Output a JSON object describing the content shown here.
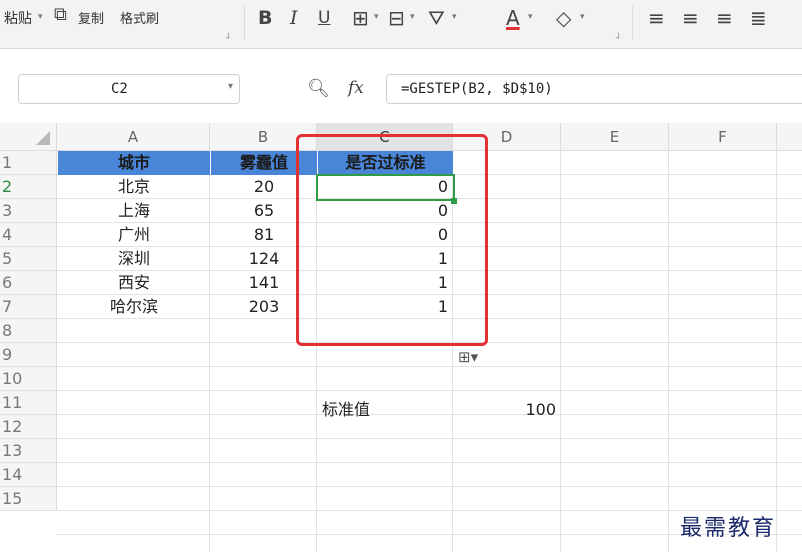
{
  "toolbar": {
    "paste_label": "粘贴",
    "copy_label": "复制",
    "format_painter_label": "格式刷",
    "bold_label": "B",
    "italic_label": "I",
    "underline_label": "U",
    "font_color_label": "A"
  },
  "formula_bar": {
    "name_box": "C2",
    "fx_label": "fx",
    "formula": "=GESTEP(B2, $D$10)"
  },
  "columns": [
    "A",
    "B",
    "C",
    "D",
    "E",
    "F"
  ],
  "rows": [
    "1",
    "2",
    "3",
    "4",
    "5",
    "6",
    "7",
    "8",
    "9",
    "10",
    "11",
    "12",
    "13",
    "14",
    "15"
  ],
  "table": {
    "headers": [
      "城市",
      "雾霾值",
      "是否过标准"
    ],
    "rows": [
      {
        "city": "北京",
        "value": "20",
        "result": "0"
      },
      {
        "city": "上海",
        "value": "65",
        "result": "0"
      },
      {
        "city": "广州",
        "value": "81",
        "result": "0"
      },
      {
        "city": "深圳",
        "value": "124",
        "result": "1"
      },
      {
        "city": "西安",
        "value": "141",
        "result": "1"
      },
      {
        "city": "哈尔滨",
        "value": "203",
        "result": "1"
      }
    ]
  },
  "standard": {
    "label": "标准值",
    "value": "100"
  },
  "watermark": "最需教育",
  "colors": {
    "header_fill": "#4a86d8",
    "active_border": "#2e9b47",
    "highlight_box": "#e03232"
  }
}
